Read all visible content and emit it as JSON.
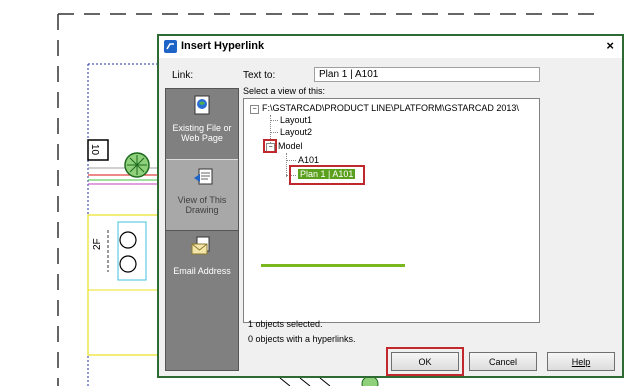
{
  "dialog": {
    "title": "Insert Hyperlink",
    "close_glyph": "×",
    "link_label": "Link:",
    "text_to_label": "Text to:",
    "text_to_value": "Plan 1 | A101",
    "select_view_label": "Select a view of this:",
    "accent_color": "#2e6b32",
    "highlight_color": "#c0282e"
  },
  "sidebar": {
    "items": [
      {
        "label": "Existing File or Web Page",
        "icon": "web-page-icon",
        "active": false
      },
      {
        "label": "View of This Drawing",
        "icon": "drawing-view-icon",
        "active": true
      },
      {
        "label": "Email Address",
        "icon": "email-icon",
        "active": false
      }
    ]
  },
  "tree": {
    "root": "F:\\GSTARCAD\\PRODUCT LINE\\PLATFORM\\GSTARCAD 2013\\",
    "root_expander": "−",
    "layout1": "Layout1",
    "layout2": "Layout2",
    "model": "Model",
    "model_expander": "−",
    "a101": "A101",
    "plan": "Plan 1 | A101"
  },
  "status": {
    "selected": "1 objects selected.",
    "hyperlinks": "0 objects with a hyperlinks."
  },
  "buttons": {
    "ok": "OK",
    "cancel": "Cancel",
    "help": "Help"
  },
  "cad": {
    "label_2f": "2F",
    "label_10": "10"
  }
}
